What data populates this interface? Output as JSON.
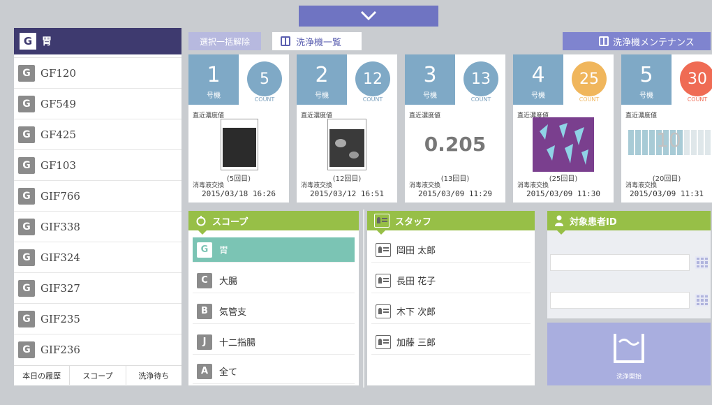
{
  "sidebar": {
    "header_badge": "G",
    "header_title": "胃",
    "items": [
      {
        "badge": "G",
        "label": "GF120"
      },
      {
        "badge": "G",
        "label": "GF549"
      },
      {
        "badge": "G",
        "label": "GF425"
      },
      {
        "badge": "G",
        "label": "GF103"
      },
      {
        "badge": "G",
        "label": "GIF766"
      },
      {
        "badge": "G",
        "label": "GIF338"
      },
      {
        "badge": "G",
        "label": "GIF324"
      },
      {
        "badge": "G",
        "label": "GIF327"
      },
      {
        "badge": "G",
        "label": "GIF235"
      },
      {
        "badge": "G",
        "label": "GIF236"
      }
    ],
    "tabs": [
      "本日の履歴",
      "スコープ",
      "洗浄待ち"
    ]
  },
  "toolbar": {
    "clear_label": "選択一括解除",
    "list_label": "洗浄機一覧",
    "maint_label": "洗浄機メンテナンス"
  },
  "machines": [
    {
      "num": "1",
      "unit": "号機",
      "count": "5",
      "count_label": "COUNT",
      "recent": "直近濃度値",
      "times": "(5回目)",
      "disinf": "消毒液交換",
      "date": "2015/03/18 16:26",
      "value": "",
      "color": "#7fa9c6"
    },
    {
      "num": "2",
      "unit": "号機",
      "count": "12",
      "count_label": "COUNT",
      "recent": "直近濃度値",
      "times": "(12回目)",
      "disinf": "消毒液交換",
      "date": "2015/03/12 16:51",
      "value": "",
      "color": "#7fa9c6"
    },
    {
      "num": "3",
      "unit": "号機",
      "count": "13",
      "count_label": "COUNT",
      "recent": "直近濃度値",
      "times": "(13回目)",
      "disinf": "消毒液交換",
      "date": "2015/03/09 11:29",
      "value": "0.205",
      "color": "#7fa9c6"
    },
    {
      "num": "4",
      "unit": "号機",
      "count": "25",
      "count_label": "COUNT",
      "recent": "直近濃度値",
      "times": "(25回目)",
      "disinf": "消毒液交換",
      "date": "2015/03/09 11:30",
      "value": "",
      "color": "#f0b65c"
    },
    {
      "num": "5",
      "unit": "号機",
      "count": "30",
      "count_label": "COUNT",
      "recent": "直近濃度値",
      "times": "(20回目)",
      "disinf": "消毒液交換",
      "date": "2015/03/09 11:31",
      "value": "10",
      "color": "#ef6b54"
    }
  ],
  "scope_panel": {
    "title": "スコープ",
    "items": [
      {
        "badge": "G",
        "label": "胃"
      },
      {
        "badge": "C",
        "label": "大腸"
      },
      {
        "badge": "B",
        "label": "気管支"
      },
      {
        "badge": "J",
        "label": "十二指腸"
      },
      {
        "badge": "A",
        "label": "全て"
      }
    ]
  },
  "staff_panel": {
    "title": "スタッフ",
    "items": [
      "岡田 太郎",
      "長田 花子",
      "木下 次郎",
      "加藤 三郎"
    ]
  },
  "patient_panel": {
    "title": "対象患者ID",
    "start_label": "洗浄開始"
  },
  "colors": {
    "primary": "#3e3a6f",
    "accent": "#6f74c2",
    "green": "#97bf47",
    "teal": "#7bc4b4",
    "machine_blue": "#7fa9c6"
  }
}
